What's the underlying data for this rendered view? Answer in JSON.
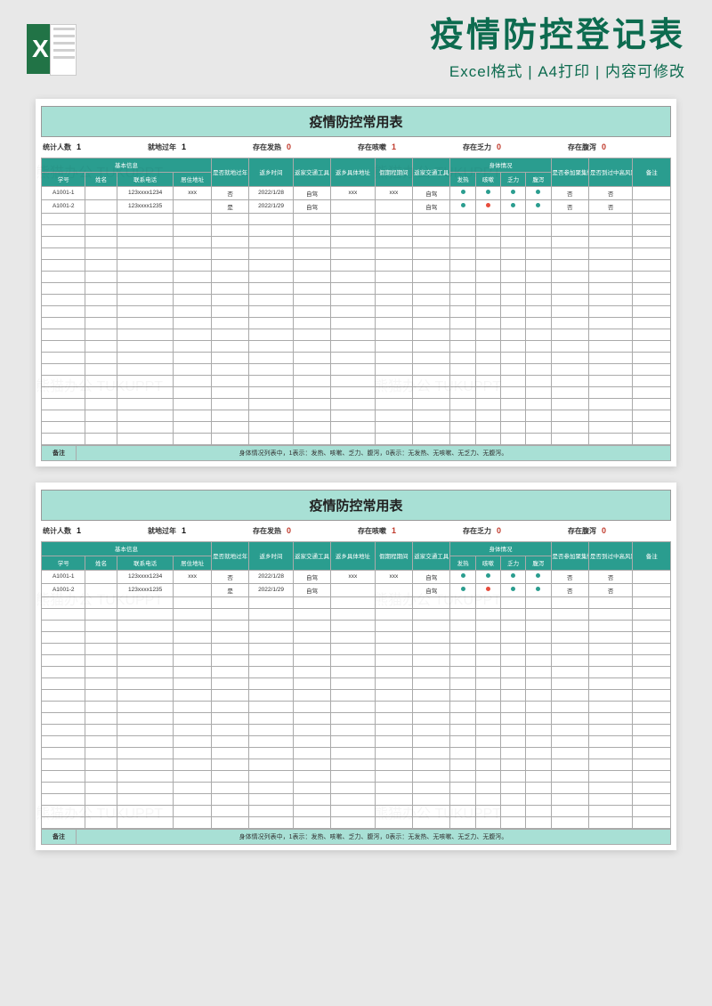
{
  "header": {
    "main_title": "疫情防控登记表",
    "sub_title": "Excel格式 | A4打印 | 内容可修改",
    "icon_letter": "X"
  },
  "sheet": {
    "title": "疫情防控常用表",
    "stats": [
      {
        "label": "统计人数",
        "value": "1",
        "cls": "black"
      },
      {
        "label": "就地过年",
        "value": "1",
        "cls": "black"
      },
      {
        "label": "存在发热",
        "value": "0",
        "cls": "red"
      },
      {
        "label": "存在咳嗽",
        "value": "1",
        "cls": "red"
      },
      {
        "label": "存在乏力",
        "value": "0",
        "cls": "red"
      },
      {
        "label": "存在腹泻",
        "value": "0",
        "cls": "red"
      }
    ],
    "header_groups": {
      "basic": "基本信息",
      "body": "身体情况"
    },
    "columns": [
      "学号",
      "姓名",
      "联系电话",
      "居住地址",
      "是否就地过年",
      "返乡时间",
      "返家交通工具",
      "返乡具体地址",
      "假期程期间",
      "返家交通工具",
      "发热",
      "咳嗽",
      "乏力",
      "腹泻",
      "是否参加聚集性活动",
      "是否到过中高风险地区",
      "备注"
    ],
    "rows": [
      {
        "id": "A1001-1",
        "name": "",
        "phone": "123xxxx1234",
        "addr": "xxx",
        "stay": "否",
        "date": "2022/1/28",
        "tran1": "自驾",
        "addr2": "xxx",
        "period": "xxx",
        "tran2": "自驾",
        "fever": "g",
        "cough": "g",
        "fatigue": "g",
        "diarr": "g",
        "gather": "否",
        "risk": "否",
        "note": ""
      },
      {
        "id": "A1001-2",
        "name": "",
        "phone": "123xxxx1235",
        "addr": "",
        "stay": "是",
        "date": "2022/1/29",
        "tran1": "自驾",
        "addr2": "",
        "period": "",
        "tran2": "自驾",
        "fever": "g",
        "cough": "r",
        "fatigue": "g",
        "diarr": "g",
        "gather": "否",
        "risk": "否",
        "note": ""
      }
    ],
    "empty_rows": 20,
    "note_label": "备注",
    "note_text": "身体情况列表中，1表示：发热、咳嗽、乏力、腹泻，0表示：无发热、无咳嗽、无乏力、无腹泻。"
  },
  "watermark_text": "熊猫办公 TUKUPPT"
}
